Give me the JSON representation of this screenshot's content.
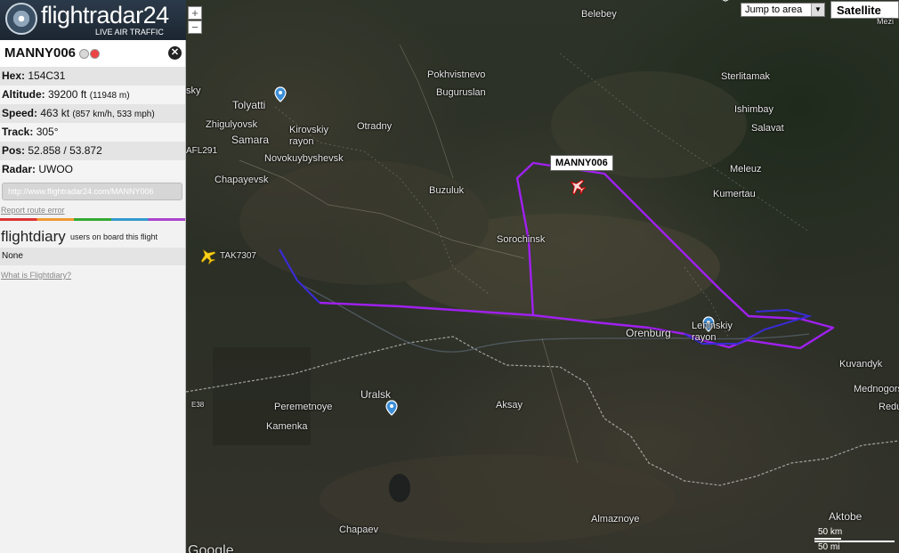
{
  "header": {
    "logo_text": "flightradar24",
    "tagline": "LIVE AIR TRAFFIC"
  },
  "sidebar": {
    "callsign": "MANNY006",
    "close_glyph": "✕",
    "hex_label": "Hex:",
    "hex_value": "154C31",
    "altitude_label": "Altitude:",
    "altitude_value": "39200 ft",
    "altitude_extra": "(11948 m)",
    "speed_label": "Speed:",
    "speed_value": "463 kt",
    "speed_extra": "(857 km/h, 533 mph)",
    "track_label": "Track:",
    "track_value": "305°",
    "pos_label": "Pos:",
    "pos_value": "52.858 / 53.872",
    "radar_label": "Radar:",
    "radar_value": "UWOO",
    "url": "http://www.flightradar24.com/MANNY006",
    "report_link": "Report route error",
    "flightdiary_logo": "flightdiary",
    "flightdiary_text": "users on board this flight",
    "onboard_value": "None",
    "what_is_link": "What is Flightdiary?"
  },
  "map": {
    "zoom_in": "+",
    "zoom_out": "−",
    "jump_label": "Jump to area",
    "map_type": "Satellite",
    "tooltip": "MANNY006",
    "aircraft": [
      {
        "label": "AFL291"
      },
      {
        "label": "TAK7307"
      }
    ],
    "places": [
      "Belebey",
      "Pokhvistnevo",
      "Buguruslan",
      "Tolyatti",
      "Zhigulyovsk",
      "Samara",
      "Kirovskiy rayon",
      "Otradny",
      "Novokuybyshevsk",
      "Chapayevsk",
      "Buzuluk",
      "Sorochinsk",
      "Sterlitamak",
      "Ishimbay",
      "Salavat",
      "Meleuz",
      "Kumertau",
      "Orenburg",
      "Leninskiy rayon",
      "Kuvandyk",
      "Mednogorsk",
      "Uralsk",
      "Peremetnoye",
      "Kamenka",
      "Aksay",
      "Chapaev",
      "Almaznoye",
      "Aktobe",
      "Redu",
      "Mezi",
      "sky",
      "E38"
    ],
    "scale_km": "50 km",
    "scale_mi": "50 mi",
    "google_text": "Google"
  },
  "colors": {
    "track_purple": "#a020f0",
    "track_blue": "#3a2bd6"
  }
}
